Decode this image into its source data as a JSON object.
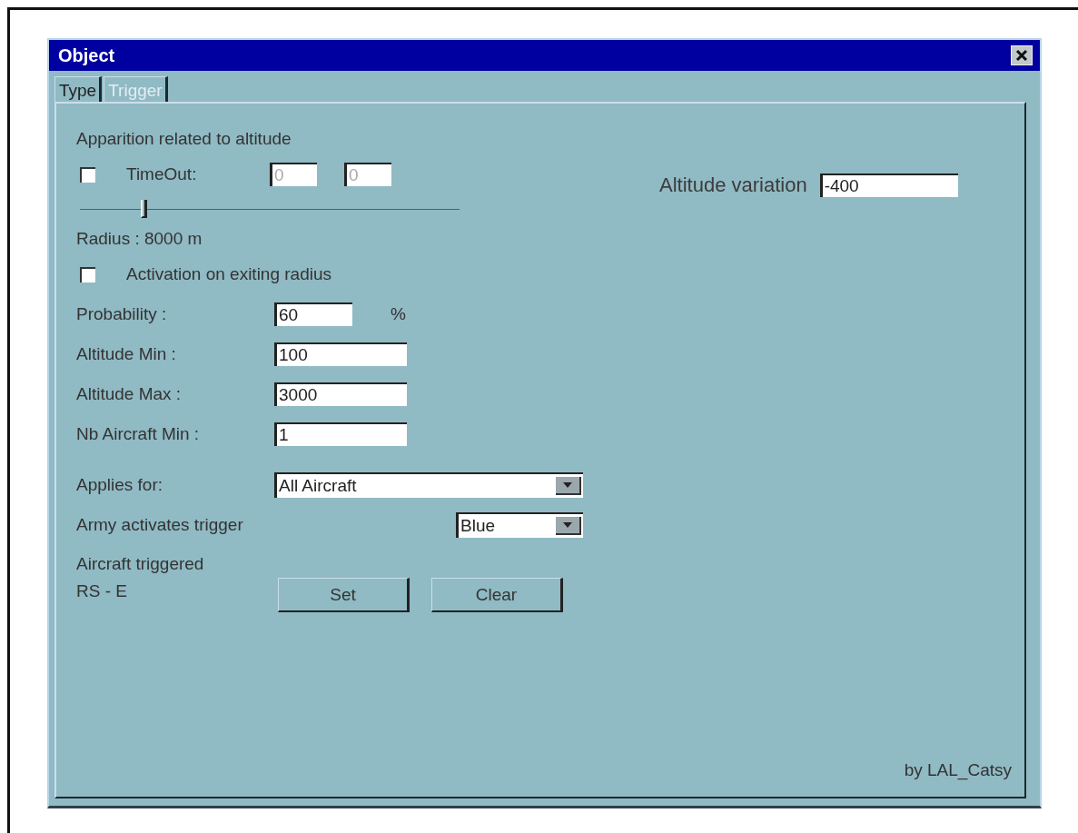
{
  "window": {
    "title": "Object"
  },
  "tabs": [
    {
      "label": "Type",
      "selected": false
    },
    {
      "label": "Trigger",
      "selected": true
    }
  ],
  "heading": "Apparition related to altitude",
  "timeout": {
    "checked": false,
    "label": "TimeOut:",
    "disabled": true,
    "values": [
      "0",
      "0"
    ]
  },
  "radius_slider": {
    "level": 0.16
  },
  "radius_label": "Radius : 8000 m",
  "exit_checkbox": {
    "checked": false,
    "label": "Activation on exiting radius"
  },
  "fields": [
    {
      "kind": "short",
      "label": "Probability :",
      "value": "60",
      "unit": "%"
    },
    {
      "kind": "normal",
      "label": "Altitude Min :",
      "value": "100"
    },
    {
      "kind": "normal",
      "label": "Altitude Max :",
      "value": "3000"
    },
    {
      "kind": "normal",
      "label": "Nb Aircraft Min :",
      "value": "1"
    }
  ],
  "applies_for": {
    "label": "Applies for:",
    "value": "All Aircraft"
  },
  "army": {
    "label": "Army activates trigger",
    "value": "Blue"
  },
  "aircraft_triggered": {
    "label": "Aircraft triggered",
    "value": "RS - E"
  },
  "buttons": [
    "Set",
    "Clear"
  ],
  "altitude_variation": {
    "label": "Altitude variation",
    "value": "-400"
  },
  "credit": "by LAL_Catsy"
}
